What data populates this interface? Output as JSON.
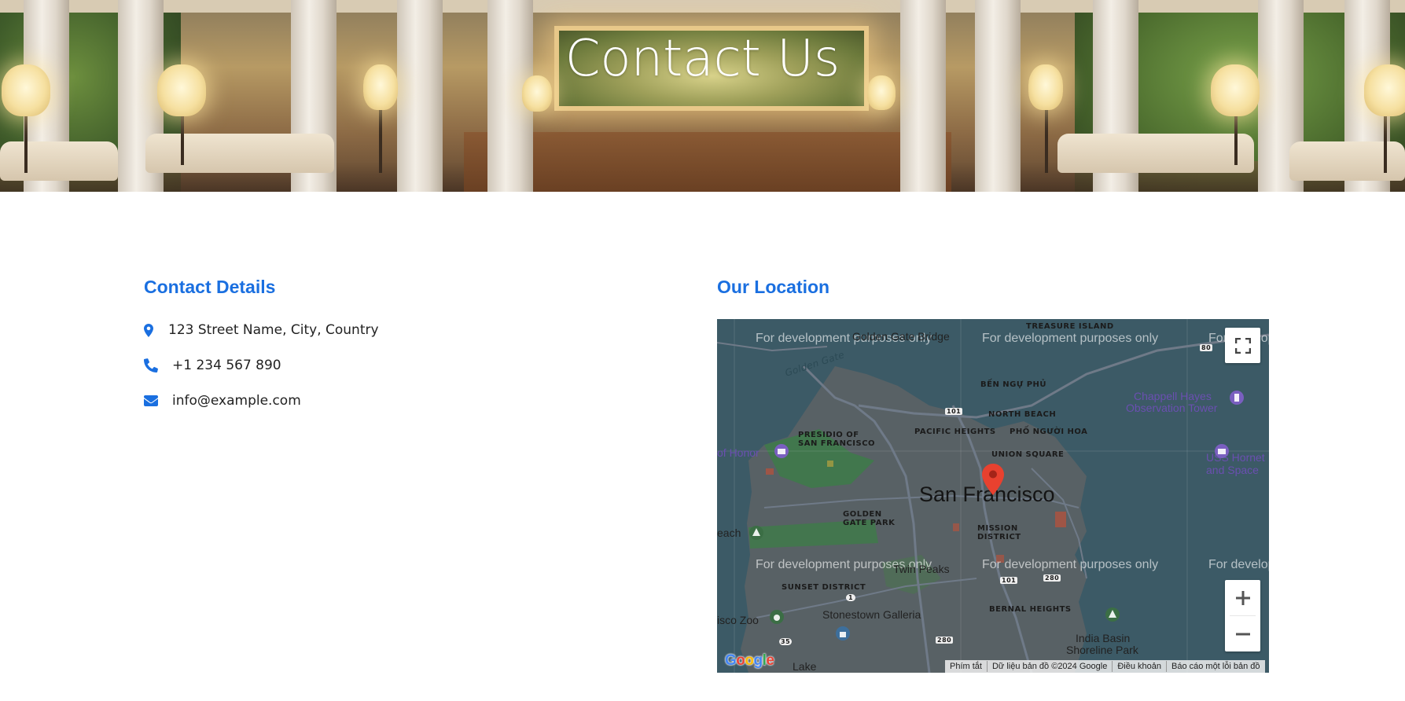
{
  "hero": {
    "title": "Contact Us"
  },
  "contact": {
    "heading": "Contact Details",
    "items": [
      {
        "icon": "map-marker-icon",
        "text": "123 Street Name, City, Country"
      },
      {
        "icon": "phone-icon",
        "text": "+1 234 567 890"
      },
      {
        "icon": "envelope-icon",
        "text": "info@example.com"
      }
    ]
  },
  "location": {
    "heading": "Our Location"
  },
  "map": {
    "watermark": "For development purposes only",
    "labels": {
      "city": "San Francisco",
      "golden_gate_bridge": "Golden Gate Bridge",
      "golden_gate": "Golden Gate",
      "treasure_island": "TREASURE ISLAND",
      "ben_ngu_phu": "BẾN NGỰ PHỦ",
      "north_beach": "NORTH BEACH",
      "pacific_heights": "PACIFIC HEIGHTS",
      "pho_nguoi_hoa": "PHỐ NGƯỜI HOA",
      "presidio": "PRESIDIO OF",
      "presidio2": "SAN FRANCISCO",
      "union_square": "UNION SQUARE",
      "chappell": "Chappell Hayes",
      "chappell2": "Observation Tower",
      "legion": "of Honor",
      "uss_hornet": "USS Hornet",
      "uss_hornet2": "and Space",
      "golden_gate_park": "GOLDEN",
      "golden_gate_park2": "GATE PARK",
      "mission": "MISSION",
      "mission2": "DISTRICT",
      "beach": "each",
      "sunset": "SUNSET DISTRICT",
      "twin_peaks": "Twin Peaks",
      "zoo": "isco Zoo",
      "stonestown": "Stonestown Galleria",
      "bernal": "BERNAL HEIGHTS",
      "india_basin": "India Basin",
      "india_basin2": "Shoreline Park",
      "lake": "Lake",
      "route_101a": "101",
      "route_101b": "101",
      "route_80": "80",
      "route_280a": "280",
      "route_280b": "280",
      "route_1": "1",
      "route_35": "35"
    },
    "google_logo": "Google",
    "attribution": [
      "Phím tắt",
      "Dữ liệu bản đồ ©2024 Google",
      "Điều khoản",
      "Báo cáo một lỗi bản đồ"
    ],
    "controls": {
      "zoom_in": "+",
      "zoom_out": "−"
    }
  },
  "colors": {
    "accent": "#1a6fe0",
    "map_overlay": "#3c5a66",
    "pin": "#e8412f"
  }
}
